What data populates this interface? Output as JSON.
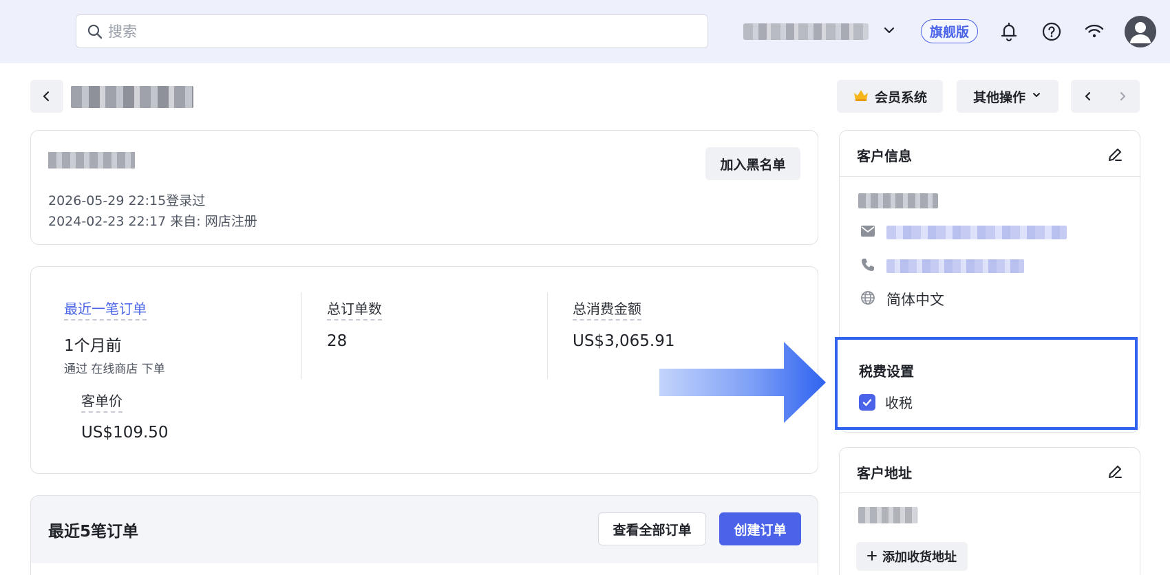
{
  "topbar": {
    "search_placeholder": "搜索",
    "plan_badge": "旗舰版"
  },
  "header": {
    "member_button": "会员系统",
    "more_actions_button": "其他操作"
  },
  "profile_card": {
    "last_login": "2026-05-29 22:15登录过",
    "registered": "2024-02-23 22:17  来自: 网店注册",
    "blacklist_button": "加入黑名单"
  },
  "stats": {
    "last_order_label": "最近一笔订单",
    "last_order_value": "1个月前",
    "last_order_sub": "通过 在线商店 下单",
    "total_orders_label": "总订单数",
    "total_orders_value": "28",
    "total_spent_label": "总消费金额",
    "total_spent_value": "US$3,065.91",
    "avg_order_label": "客单价",
    "avg_order_value": "US$109.50"
  },
  "recent_orders": {
    "title": "最近5笔订单",
    "view_all_button": "查看全部订单",
    "create_button": "创建订单"
  },
  "customer_info": {
    "title": "客户信息",
    "language": "简体中文"
  },
  "tax_settings": {
    "title": "税费设置",
    "collect_tax_label": "收税",
    "collect_tax_checked": true
  },
  "address": {
    "title": "客户地址",
    "add_button": "添加收货地址"
  },
  "colors": {
    "accent": "#4a63e8",
    "highlight": "#2f63f0",
    "topbar_bg": "#eef0fb"
  }
}
